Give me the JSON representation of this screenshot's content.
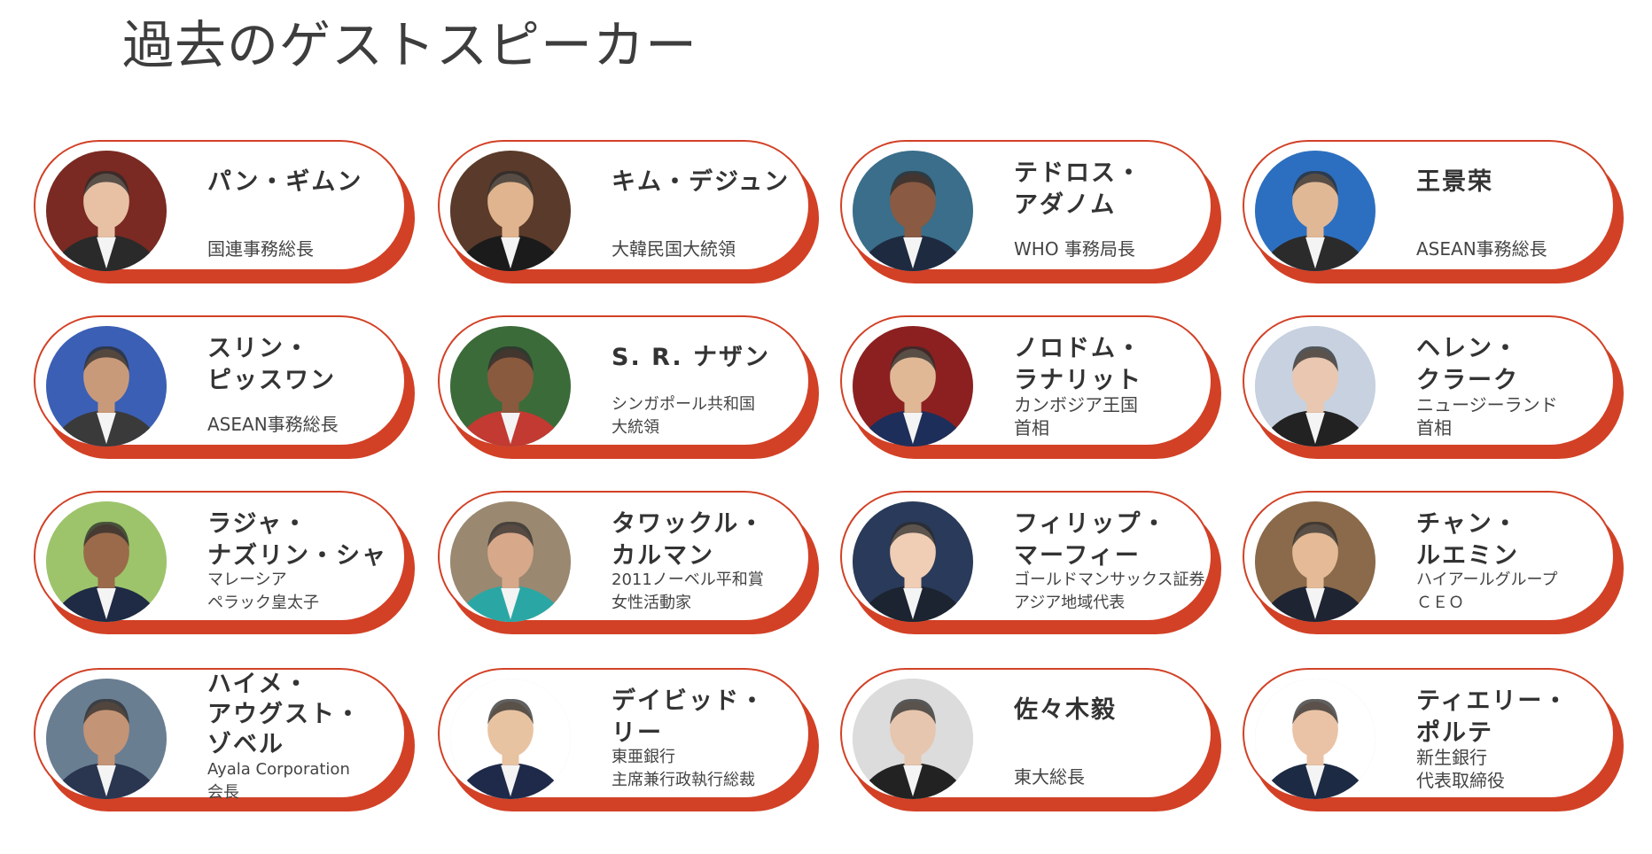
{
  "page": {
    "title": "過去のゲストスピーカー"
  },
  "speakers": [
    {
      "name": "パン・ギムン",
      "role": "国連事務総長"
    },
    {
      "name": "キム・デジュン",
      "role": "大韓民国大統領"
    },
    {
      "name": "テドロス・\nアダノム",
      "role": "WHO 事務局長"
    },
    {
      "name": "王景荣",
      "role": "ASEAN事務総長"
    },
    {
      "name": "スリン・\nピッスワン",
      "role": "ASEAN事務総長"
    },
    {
      "name": "S. R. ナザン",
      "role": "シンガポール共和国\n大統領"
    },
    {
      "name": "ノロドム・\nラナリット",
      "role": "カンボジア王国\n首相"
    },
    {
      "name": "ヘレン・\nクラーク",
      "role": "ニュージーランド\n首相"
    },
    {
      "name": "ラジャ・\nナズリン・シャ",
      "role": "マレーシア\nペラック皇太子"
    },
    {
      "name": "タワックル・\nカルマン",
      "role": "2011ノーベル平和賞\n女性活動家"
    },
    {
      "name": "フィリップ・\nマーフィー",
      "role": "ゴールドマンサックス証券\nアジア地域代表"
    },
    {
      "name": "チャン・\nルエミン",
      "role": "ハイアールグループ\n ＣＥＯ"
    },
    {
      "name": "ハイメ・\nアウグスト・\nゾベル",
      "role": "Ayala Corporation\n会長"
    },
    {
      "name": "デイビッド・\nリー",
      "role": "東亜銀行\n主席兼行政執行総裁"
    },
    {
      "name": "佐々木毅",
      "role": "東大総長"
    },
    {
      "name": "ティエリー・\nポルテ",
      "role": "新生銀行\n代表取締役"
    }
  ]
}
